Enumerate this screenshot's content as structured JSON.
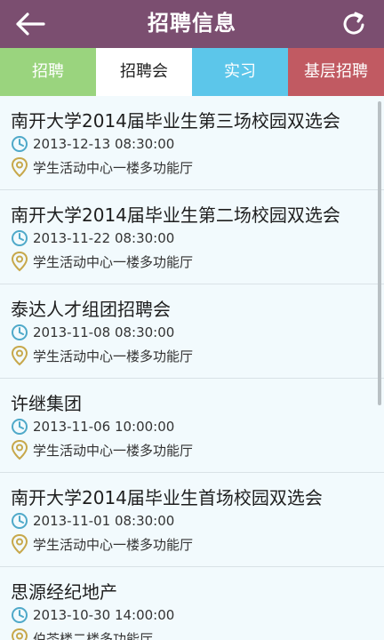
{
  "header": {
    "title": "招聘信息",
    "back_icon": "back-arrow-icon",
    "refresh_icon": "refresh-icon"
  },
  "tabs": [
    {
      "label": "招聘",
      "color": "#9ad47e"
    },
    {
      "label": "招聘会",
      "color": "#ffffff",
      "selected": true
    },
    {
      "label": "实习",
      "color": "#5cc6ea"
    },
    {
      "label": "基层招聘",
      "color": "#c15a62"
    }
  ],
  "events": [
    {
      "name": "南开大学2014届毕业生第三场校园双选会",
      "time": "2013-12-13 08:30:00",
      "place": "学生活动中心一楼多功能厅"
    },
    {
      "name": "南开大学2014届毕业生第二场校园双选会",
      "time": "2013-11-22 08:30:00",
      "place": "学生活动中心一楼多功能厅"
    },
    {
      "name": "泰达人才组团招聘会",
      "time": "2013-11-08 08:30:00",
      "place": "学生活动中心一楼多功能厅"
    },
    {
      "name": "许继集团",
      "time": "2013-11-06 10:00:00",
      "place": "学生活动中心一楼多功能厅"
    },
    {
      "name": "南开大学2014届毕业生首场校园双选会",
      "time": "2013-11-01 08:30:00",
      "place": "学生活动中心一楼多功能厅"
    },
    {
      "name": "思源经纪地产",
      "time": "2013-10-30 14:00:00",
      "place": "伯苓楼二楼多功能厅"
    }
  ],
  "colors": {
    "header_bg": "#7b4e70",
    "clock_icon": "#4fa9c9",
    "pin_icon": "#c7a84b"
  }
}
